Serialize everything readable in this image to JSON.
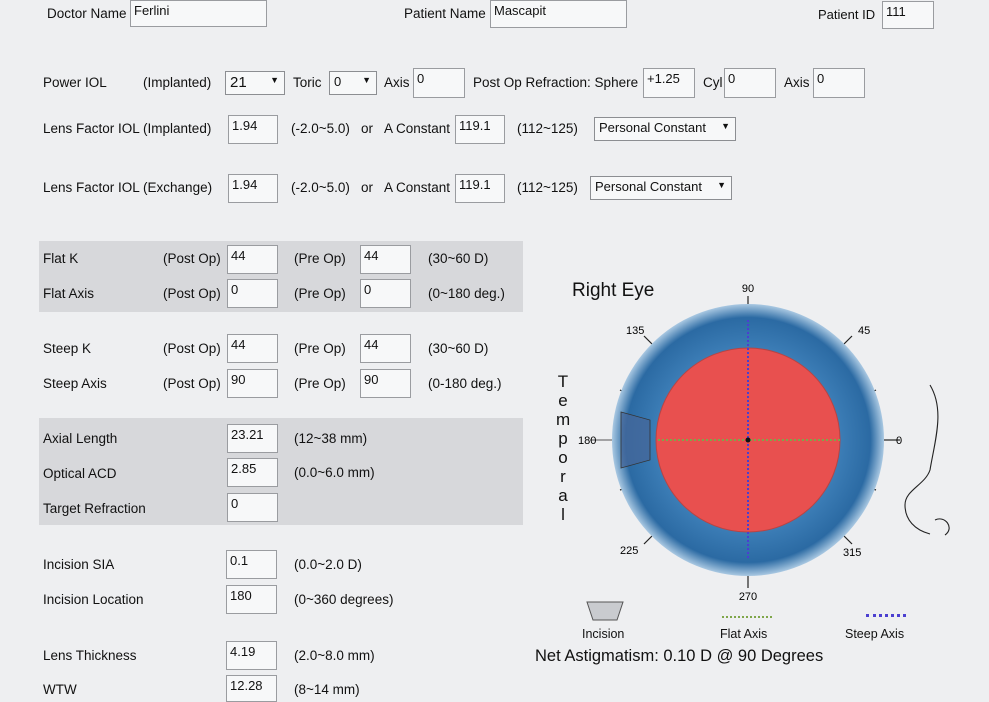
{
  "header": {
    "doctor_label": "Doctor Name",
    "doctor_value": "Ferlini",
    "patient_label": "Patient Name",
    "patient_value": "Mascapit",
    "patient_id_label": "Patient ID",
    "patient_id_value": "111"
  },
  "power": {
    "label": "Power IOL",
    "implanted_label": "(Implanted)",
    "implanted_value": "21",
    "toric_label": "Toric",
    "toric_value": "0",
    "axis_label": "Axis",
    "axis_value": "0",
    "refraction_label": "Post Op Refraction: Sphere",
    "sphere_value": "+1.25",
    "cyl_label": "Cyl",
    "cyl_value": "0",
    "axis2_label": "Axis",
    "axis2_value": "0"
  },
  "lens_implanted": {
    "label": "Lens Factor IOL (Implanted)",
    "value": "1.94",
    "range": "(-2.0~5.0)",
    "or": "or",
    "aconst_label": "A Constant",
    "aconst_value": "119.1",
    "aconst_range": "(112~125)",
    "select": "Personal Constant"
  },
  "lens_exchange": {
    "label": "Lens Factor IOL (Exchange)",
    "value": "1.94",
    "range": "(-2.0~5.0)",
    "or": "or",
    "aconst_label": "A Constant",
    "aconst_value": "119.1",
    "aconst_range": "(112~125)",
    "select": "Personal Constant"
  },
  "k": {
    "post_op": "(Post Op)",
    "pre_op": "(Pre Op)",
    "flat_k": {
      "label": "Flat K",
      "post": "44",
      "pre": "44",
      "range": "(30~60 D)"
    },
    "flat_axis": {
      "label": "Flat Axis",
      "post": "0",
      "pre": "0",
      "range": "(0~180 deg.)"
    },
    "steep_k": {
      "label": "Steep K",
      "post": "44",
      "pre": "44",
      "range": "(30~60 D)"
    },
    "steep_axis": {
      "label": "Steep Axis",
      "post": "90",
      "pre": "90",
      "range": "(0-180 deg.)"
    }
  },
  "biometry": {
    "axial_length": {
      "label": "Axial Length",
      "value": "23.21",
      "range": "(12~38 mm)"
    },
    "optical_acd": {
      "label": "Optical ACD",
      "value": "2.85",
      "range": "(0.0~6.0 mm)"
    },
    "target_refraction": {
      "label": "Target Refraction",
      "value": "0"
    }
  },
  "incision": {
    "sia": {
      "label": "Incision SIA",
      "value": "0.1",
      "range": "(0.0~2.0 D)"
    },
    "location": {
      "label": "Incision Location",
      "value": "180",
      "range": "(0~360 degrees)"
    }
  },
  "lens_thickness": {
    "label": "Lens Thickness",
    "value": "4.19",
    "range": "(2.0~8.0 mm)"
  },
  "wtw": {
    "label": "WTW",
    "value": "12.28",
    "range": "(8~14 mm)"
  },
  "diagram": {
    "title": "Right Eye",
    "temporal_letters": [
      "T",
      "e",
      "m",
      "p",
      "o",
      "r",
      "a",
      "l"
    ],
    "angles": {
      "a90": "90",
      "a45": "45",
      "a135": "135",
      "a180": "180",
      "a0": "0",
      "a225": "225",
      "a315": "315",
      "a270": "270"
    },
    "legend": {
      "incision": "Incision",
      "flat_axis": "Flat Axis",
      "steep_axis": "Steep Axis"
    },
    "net_astigmatism": "Net Astigmatism: 0.10 D @ 90 Degrees",
    "colors": {
      "lens": "#e8504f",
      "flat_axis": "#7fa64a",
      "steep_axis": "#4b3fd0",
      "cornea": "#2f6fa8"
    }
  }
}
